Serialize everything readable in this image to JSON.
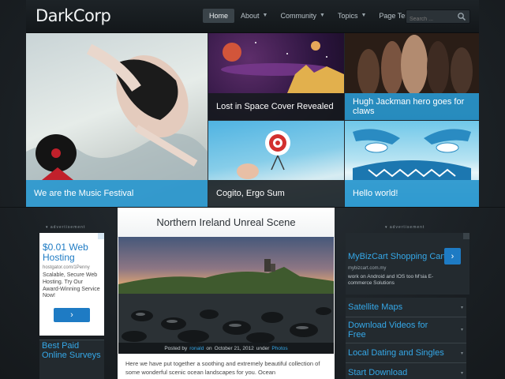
{
  "site": {
    "logo": "DarkCorp"
  },
  "nav": {
    "items": [
      {
        "label": "Home",
        "active": true,
        "has_caret": false
      },
      {
        "label": "About",
        "active": false,
        "has_caret": true
      },
      {
        "label": "Community",
        "active": false,
        "has_caret": true
      },
      {
        "label": "Topics",
        "active": false,
        "has_caret": true
      },
      {
        "label": "Page Templates",
        "active": false,
        "has_caret": true
      }
    ],
    "search_placeholder": "Search ...",
    "search_icon": "magnifier-icon"
  },
  "features": [
    {
      "caption": "We are the Music Festival",
      "caption_color": "#2896cd"
    },
    {
      "caption": "Lost in Space Cover Revealed",
      "caption_color": "#16191d"
    },
    {
      "caption": "Hugh Jackman hero goes for claws",
      "caption_color": "#2896cd"
    },
    {
      "caption": "Cogito, Ergo Sum",
      "caption_color": "#16191d"
    },
    {
      "caption": "Hello world!",
      "caption_color": "#2896cd"
    }
  ],
  "ad_label": "advertisement",
  "left_ad": {
    "title": "$0.01 Web Hosting",
    "url": "hostgator.com/1Penny",
    "text": "Scalable, Secure Web Hosting. Try Our Award-Winning Service Now!",
    "button_icon": "chevron-right-icon"
  },
  "left_links": [
    "Best Paid Online Surveys"
  ],
  "post": {
    "title": "Northern Ireland Unreal Scene",
    "posted_by_prefix": "Posted by",
    "author": "ronald",
    "date_prefix": "on",
    "date": "October 21, 2012",
    "category_prefix": "under",
    "category": "Photos",
    "excerpt": "Here we have put together a soothing and extremely beautiful collection of some wonderful scenic ocean landscapes for you. Ocean"
  },
  "right_ad": {
    "title": "MyBizCart Shopping Cart",
    "url": "mybizcart.com.my",
    "text": "work on Android and IOS too M'sia E-commerce Solutions",
    "button_icon": "chevron-right-icon"
  },
  "right_links": [
    {
      "label": "Satellite Maps"
    },
    {
      "label": "Download Videos for Free"
    },
    {
      "label": "Local Dating and Singles"
    },
    {
      "label": "Start Download"
    }
  ],
  "colors": {
    "accent": "#35a8e8",
    "caption_blue": "#2896cd",
    "background": "#1b2126"
  }
}
